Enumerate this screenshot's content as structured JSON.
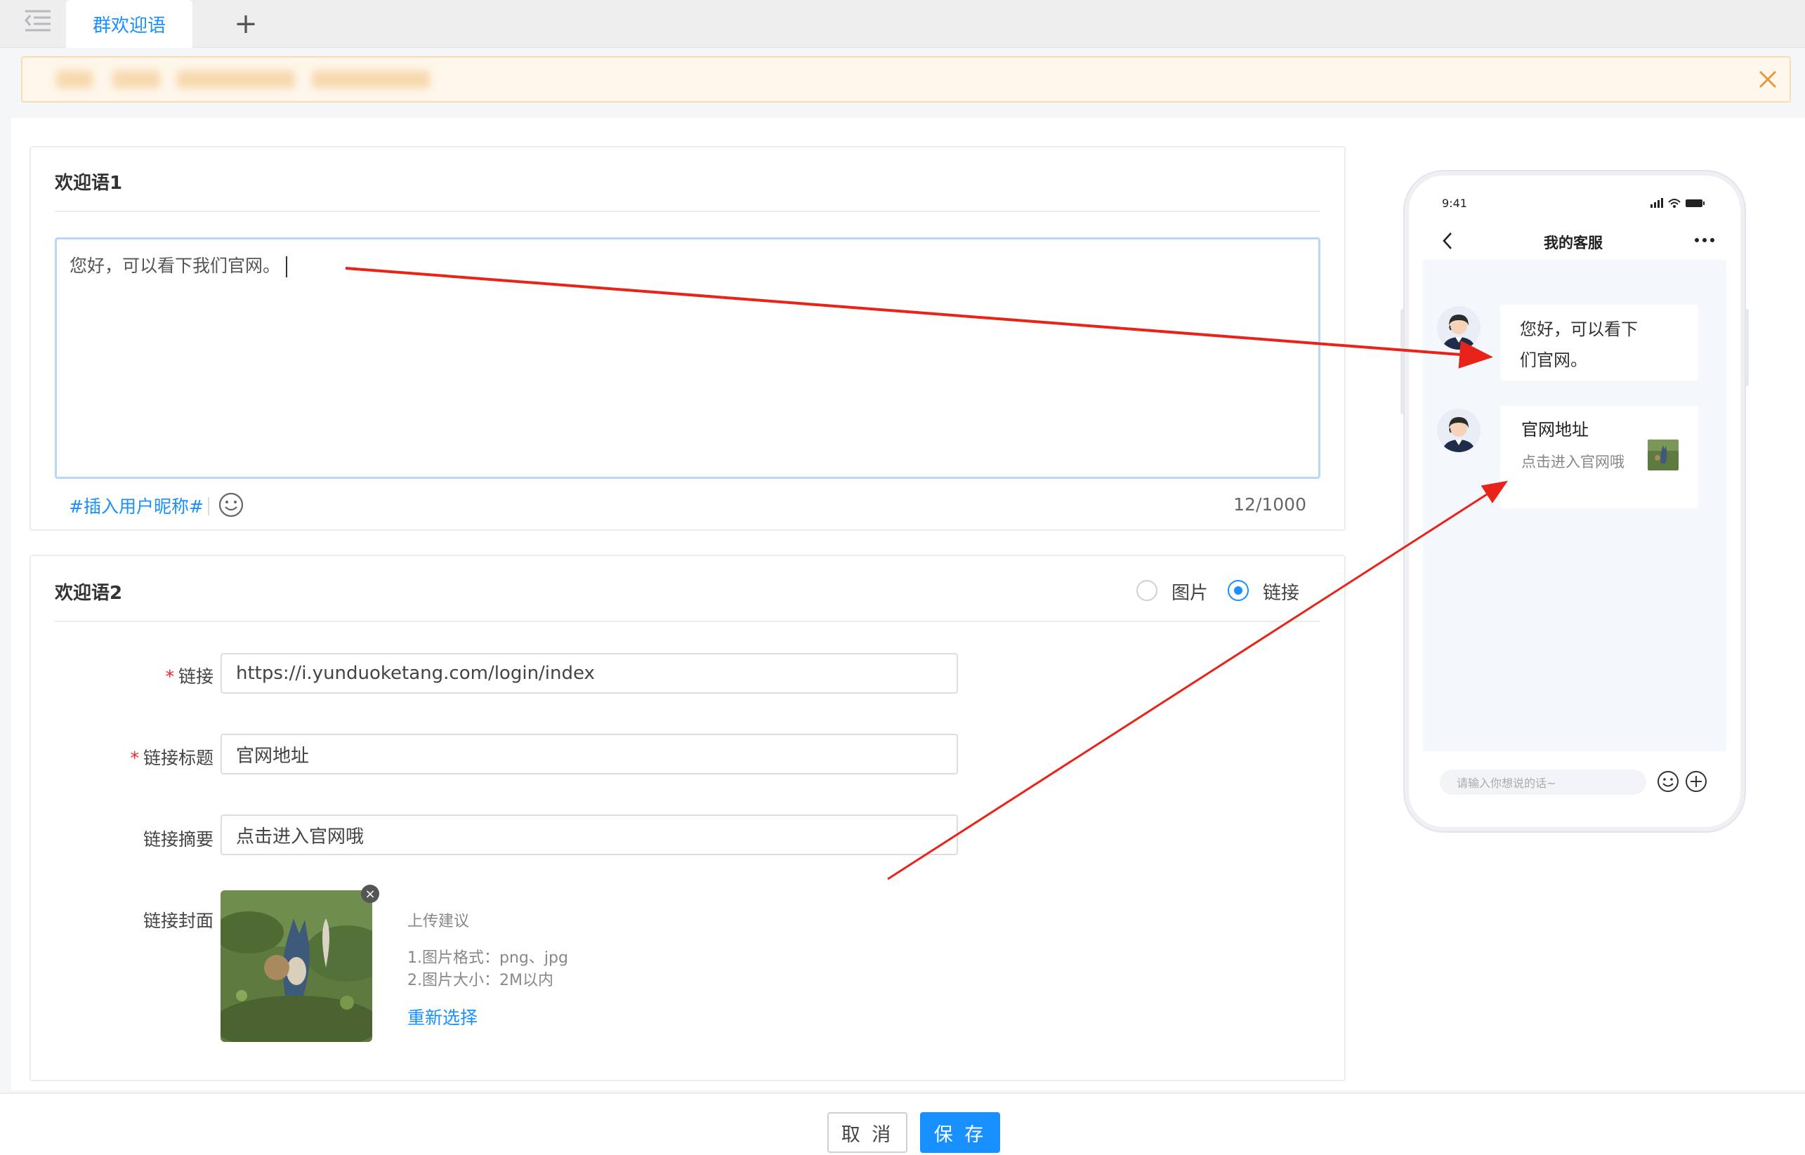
{
  "tabs": {
    "active_label": "群欢迎语",
    "add_label": "+"
  },
  "welcome1": {
    "title": "欢迎语1",
    "text": "您好，可以看下我们官网。",
    "insert_nickname": "#插入用户昵称#",
    "counter": "12/1000"
  },
  "welcome2": {
    "title": "欢迎语2",
    "type_options": [
      "图片",
      "链接"
    ],
    "selected_type": "链接",
    "link_label": "链接",
    "link_value": "https://i.yunduoketang.com/login/index",
    "link_title_label": "链接标题",
    "link_title_value": "官网地址",
    "link_summary_label": "链接摘要",
    "link_summary_value": "点击进入官网哦",
    "link_cover_label": "链接封面",
    "upload_hint_title": "上传建议",
    "upload_hint_1": "1.图片格式：png、jpg",
    "upload_hint_2": "2.图片大小：2M以内",
    "reselect": "重新选择"
  },
  "footer": {
    "cancel": "取 消",
    "save": "保 存"
  },
  "phone": {
    "time": "9:41",
    "title": "我的客服",
    "message_line1": "您好，可以看下",
    "message_line2": "们官网。",
    "link_card_title": "官网地址",
    "link_card_desc": "点击进入官网哦",
    "input_placeholder": "请输入你想说的话~"
  },
  "colors": {
    "primary": "#1890ff",
    "required": "#f5222d",
    "notice_bg": "#fff7ec",
    "annotation_arrow": "#e8231a"
  }
}
